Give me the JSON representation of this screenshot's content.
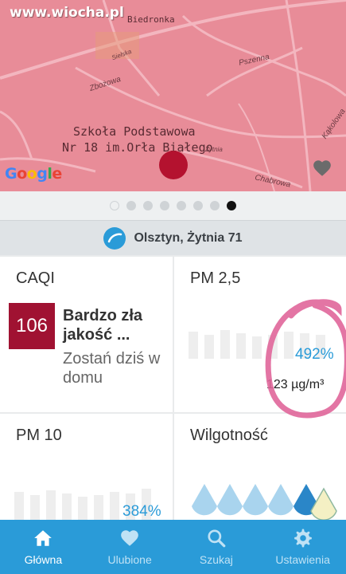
{
  "watermark": "www.wiocha.pl",
  "map": {
    "labels": {
      "top_fragment": "Biedronka",
      "school_line1": "Szkoła Podstawowa",
      "school_line2": "Nr 18 im.Orła Białego",
      "street_pszenna": "Pszenna",
      "street_zbozowa": "Zbożowa",
      "street_kakolowa": "Kąkolowa",
      "street_chabrowa": "Chabrowa",
      "street_zytnia": "Żytnia",
      "street_sielska": "Sielska"
    },
    "google_logo": "Google",
    "pin_color": "#b4122f",
    "map_color": "#e88c98"
  },
  "pager": {
    "count": 7,
    "active_index": 7
  },
  "location": {
    "name": "Olsztyn, Żytnia 71",
    "icon": "location-logo-icon"
  },
  "cards": {
    "caqi": {
      "title": "CAQI",
      "value": "106",
      "value_color": "#a01232",
      "status": "Bardzo zła jakość ...",
      "advice": "Zostań dziś w domu"
    },
    "pm25": {
      "title": "PM 2,5",
      "percent": "492%",
      "concentration": "123 µg/m³"
    },
    "pm10": {
      "title": "PM 10",
      "percent": "384%"
    },
    "humidity": {
      "title": "Wilgotność"
    }
  },
  "nav": {
    "items": [
      {
        "label": "Główna",
        "icon": "home-icon",
        "active": true
      },
      {
        "label": "Ulubione",
        "icon": "heart-icon",
        "active": false
      },
      {
        "label": "Szukaj",
        "icon": "search-icon",
        "active": false
      },
      {
        "label": "Ustawienia",
        "icon": "settings-icon",
        "active": false
      }
    ],
    "color": "#2a9bd8"
  },
  "annotation": {
    "circle_color": "#e0669a"
  }
}
